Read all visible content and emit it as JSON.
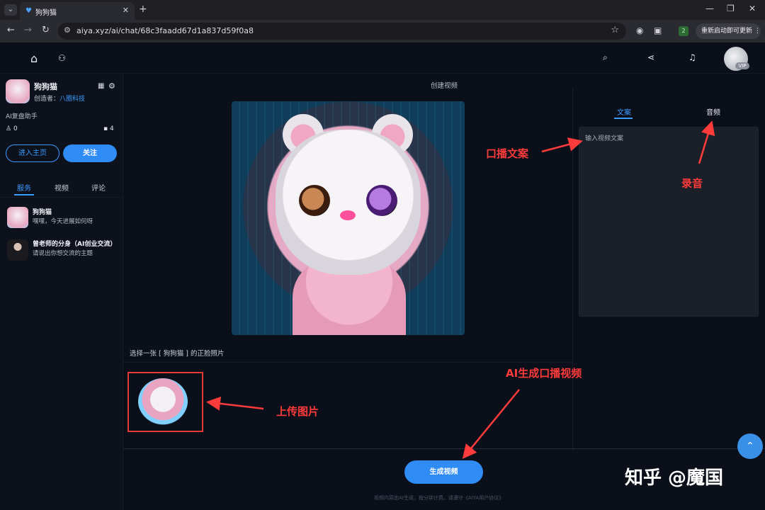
{
  "browser": {
    "tab_title": "狗狗猫",
    "url": "aiya.xyz/ai/chat/68c3faadd67d1a837d59f0a8",
    "update_label": "重新启动即可更新",
    "ext_badge": "2"
  },
  "header": {
    "vip_label": "VIP"
  },
  "sidebar": {
    "bot_name": "狗狗猫",
    "creator_label": "创造者：",
    "creator_name": "八圈科技",
    "description": "AI复盘助手",
    "followers": "0",
    "messages": "4",
    "home_button": "进入主页",
    "follow_button": "关注",
    "tabs": [
      "服务",
      "视频",
      "评论"
    ],
    "chats": [
      {
        "name": "狗狗猫",
        "message": "嘿嘿，今天进展如何呀"
      },
      {
        "name": "曾老师的分身（AI创业交流）",
        "message": "请说出你想交流的主题"
      }
    ]
  },
  "main": {
    "title": "创建视频",
    "select_label": "选择一张 [ 狗狗猫 ] 的正脸照片",
    "generate_button": "生成视频",
    "footer_note": "视频内容由AI生成，按分钟计费。请遵守《AIYA用户协议》"
  },
  "right_panel": {
    "tabs": [
      "文案",
      "音频"
    ],
    "placeholder": "输入视频文案"
  },
  "annotations": {
    "script": "口播文案",
    "record": "录音",
    "upload": "上传图片",
    "generate": "AI生成口播视频"
  },
  "watermark": "知乎 @魔国",
  "colors": {
    "accent": "#2f8cf5",
    "annotation": "#ff3b3b",
    "background": "#0b0f1a"
  }
}
